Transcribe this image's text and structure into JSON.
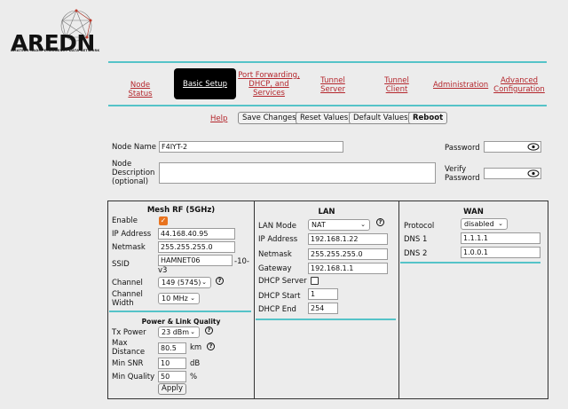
{
  "logo": {
    "title": "AREDN",
    "subtitle": "AMATEUR RADIO EMERGENCY DATA NETWORK"
  },
  "nav": {
    "node_status": "Node Status",
    "basic_setup": "Basic Setup",
    "port_forwarding": [
      "Port Forwarding,",
      "DHCP, and",
      "Services"
    ],
    "tunnel_server": [
      "Tunnel",
      "Server"
    ],
    "tunnel_client": [
      "Tunnel",
      "Client"
    ],
    "administration": "Administration",
    "advanced_configuration": [
      "Advanced",
      "Configuration"
    ]
  },
  "toolbar": {
    "help": "Help",
    "save_changes": "Save Changes",
    "reset_values": "Reset Values",
    "default_values": "Default Values",
    "reboot": "Reboot"
  },
  "node": {
    "name_label": "Node Name",
    "name_value": "F4IYT-2",
    "description_label": [
      "Node",
      "Description",
      "(optional)"
    ],
    "description_value": "",
    "password_label": "Password",
    "verify_password_label": [
      "Verify",
      "Password"
    ]
  },
  "mesh_rf": {
    "title": "Mesh RF (5GHz)",
    "enable_label": "Enable",
    "ip_label": "IP Address",
    "ip_value": "44.168.40.95",
    "netmask_label": "Netmask",
    "netmask_value": "255.255.255.0",
    "ssid_label": "SSID",
    "ssid_value": "HAMNET06",
    "ssid_suffix_a": "-10-",
    "ssid_suffix_b": "v3",
    "channel_label": "Channel",
    "channel_value": "149 (5745)",
    "channel_width_label": [
      "Channel",
      "Width"
    ],
    "channel_width_value": "10 MHz"
  },
  "power": {
    "title": "Power & Link Quality",
    "tx_power_label": "Tx Power",
    "tx_power_value": "23 dBm",
    "max_distance_label": [
      "Max",
      "Distance"
    ],
    "max_distance_value": "80.5",
    "max_distance_unit": "km",
    "min_snr_label": "Min SNR",
    "min_snr_value": "10",
    "min_snr_unit": "dB",
    "min_quality_label": "Min Quality",
    "min_quality_value": "50",
    "min_quality_unit": "%",
    "apply": "Apply"
  },
  "lan": {
    "title": "LAN",
    "mode_label": "LAN Mode",
    "mode_value": "NAT",
    "ip_label": "IP Address",
    "ip_value": "192.168.1.22",
    "netmask_label": "Netmask",
    "netmask_value": "255.255.255.0",
    "gateway_label": "Gateway",
    "gateway_value": "192.168.1.1",
    "dhcp_server_label": "DHCP Server",
    "dhcp_start_label": "DHCP Start",
    "dhcp_start_value": "1",
    "dhcp_end_label": "DHCP End",
    "dhcp_end_value": "254"
  },
  "wan": {
    "title": "WAN",
    "protocol_label": "Protocol",
    "protocol_value": "disabled",
    "dns1_label": "DNS 1",
    "dns1_value": "1.1.1.1",
    "dns2_label": "DNS 2",
    "dns2_value": "1.0.0.1"
  },
  "colors": {
    "accent": "#55c3c8",
    "link": "#b4262c",
    "checkbox": "#e8731e"
  }
}
